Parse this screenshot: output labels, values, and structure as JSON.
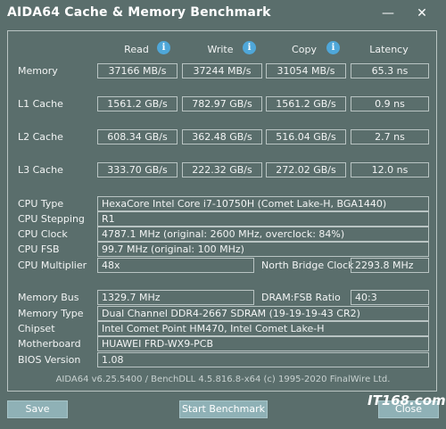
{
  "window": {
    "title": "AIDA64 Cache & Memory Benchmark",
    "minimize_glyph": "—",
    "close_glyph": "✕"
  },
  "columns": {
    "read": "Read",
    "write": "Write",
    "copy": "Copy",
    "latency": "Latency",
    "info_glyph": "i"
  },
  "rows": [
    {
      "label": "Memory",
      "read": "37166 MB/s",
      "write": "37244 MB/s",
      "copy": "31054 MB/s",
      "latency": "65.3 ns"
    },
    {
      "label": "L1 Cache",
      "read": "1561.2 GB/s",
      "write": "782.97 GB/s",
      "copy": "1561.2 GB/s",
      "latency": "0.9 ns"
    },
    {
      "label": "L2 Cache",
      "read": "608.34 GB/s",
      "write": "362.48 GB/s",
      "copy": "516.04 GB/s",
      "latency": "2.7 ns"
    },
    {
      "label": "L3 Cache",
      "read": "333.70 GB/s",
      "write": "222.32 GB/s",
      "copy": "272.02 GB/s",
      "latency": "12.0 ns"
    }
  ],
  "cpu": {
    "type_label": "CPU Type",
    "type": "HexaCore Intel Core i7-10750H  (Comet Lake-H, BGA1440)",
    "stepping_label": "CPU Stepping",
    "stepping": "R1",
    "clock_label": "CPU Clock",
    "clock": "4787.1 MHz  (original: 2600 MHz, overclock: 84%)",
    "fsb_label": "CPU FSB",
    "fsb": "99.7 MHz  (original: 100 MHz)",
    "multiplier_label": "CPU Multiplier",
    "multiplier": "48x",
    "nb_clock_label": "North Bridge Clock",
    "nb_clock": "2293.8 MHz"
  },
  "memory": {
    "bus_label": "Memory Bus",
    "bus": "1329.7 MHz",
    "ratio_label": "DRAM:FSB Ratio",
    "ratio": "40:3",
    "type_label": "Memory Type",
    "type": "Dual Channel DDR4-2667 SDRAM  (19-19-19-43 CR2)",
    "chipset_label": "Chipset",
    "chipset": "Intel Comet Point HM470, Intel Comet Lake-H",
    "motherboard_label": "Motherboard",
    "motherboard": "HUAWEI FRD-WX9-PCB",
    "bios_label": "BIOS Version",
    "bios": "1.08"
  },
  "footer": {
    "text": "AIDA64 v6.25.5400 / BenchDLL 4.5.816.8-x64  (c) 1995-2020 FinalWire Ltd."
  },
  "buttons": {
    "save": "Save",
    "start": "Start Benchmark",
    "close": "Close"
  },
  "watermark": "IT168.com"
}
